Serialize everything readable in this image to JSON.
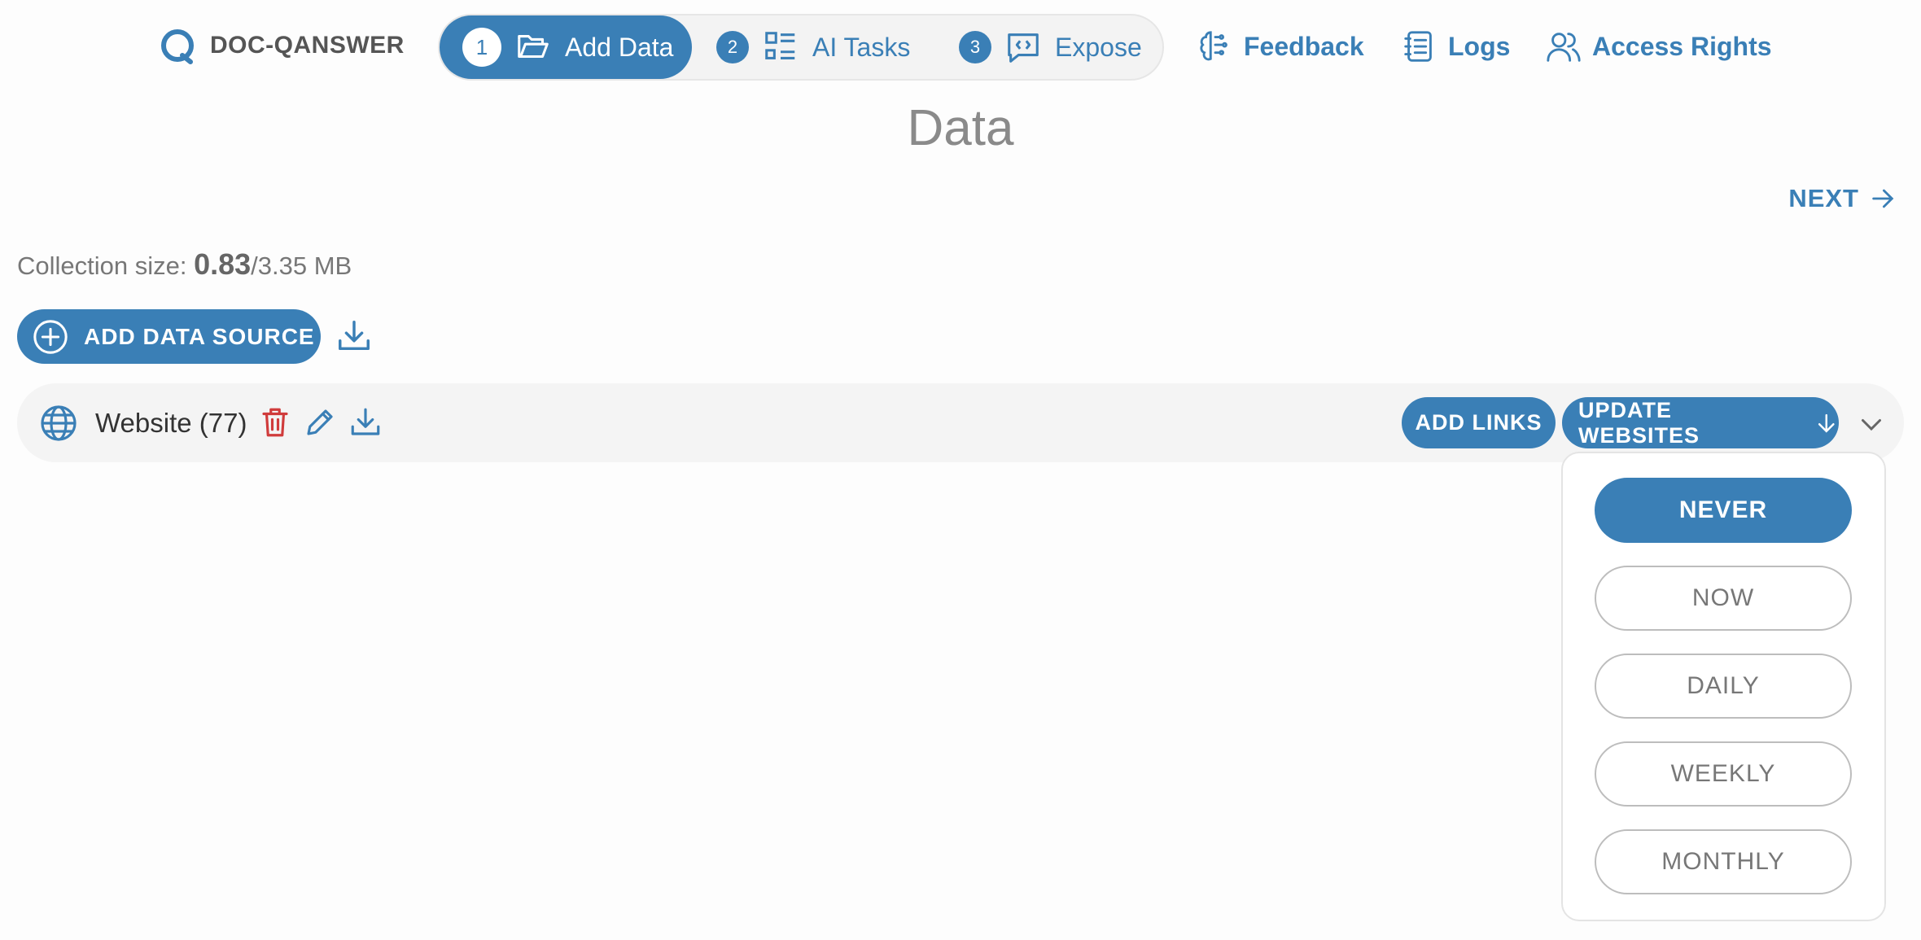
{
  "brand": {
    "name": "DOC-QANSWER"
  },
  "steps": [
    {
      "num": "1",
      "label": "Add Data",
      "icon": "folder-open-icon",
      "active": true
    },
    {
      "num": "2",
      "label": "AI Tasks",
      "icon": "list-grid-icon",
      "active": false
    },
    {
      "num": "3",
      "label": "Expose",
      "icon": "chat-code-icon",
      "active": false
    }
  ],
  "nav": {
    "feedback": "Feedback",
    "logs": "Logs",
    "access_rights": "Access Rights"
  },
  "page": {
    "title": "Data",
    "next": "NEXT"
  },
  "collection": {
    "prefix": "Collection size: ",
    "used": "0.83",
    "total": "/3.35 MB"
  },
  "actions": {
    "add_data_source": "ADD DATA SOURCE"
  },
  "source": {
    "label": "Website (77)",
    "add_links": "ADD LINKS",
    "update_websites": "UPDATE WEBSITES"
  },
  "update_menu": {
    "options": [
      "NEVER",
      "NOW",
      "DAILY",
      "WEEKLY",
      "MONTHLY"
    ],
    "selected": "NEVER"
  },
  "colors": {
    "accent": "#3a7fb6",
    "danger": "#d03b3b",
    "muted": "#8a8a8a"
  }
}
